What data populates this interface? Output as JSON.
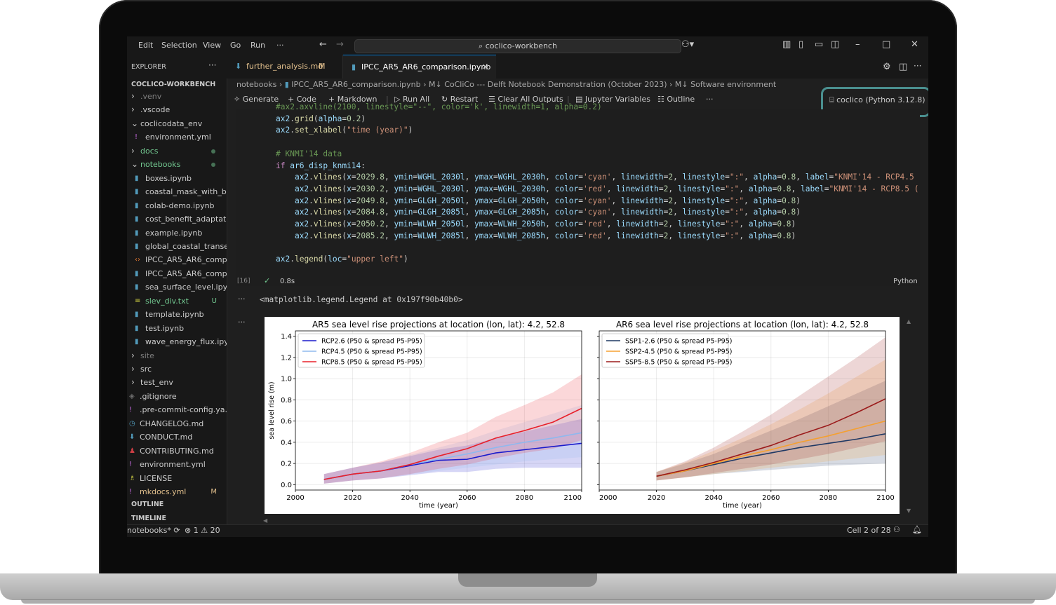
{
  "menu": [
    "Edit",
    "Selection",
    "View",
    "Go",
    "Run",
    "···"
  ],
  "search": {
    "label": "coclico-workbench"
  },
  "explorer": {
    "header": "EXPLORER",
    "root": "COCLICO-WORKBENCH",
    "items": [
      {
        "label": ".venv",
        "kind": "folder",
        "depth": 0,
        "open": false,
        "color": "#7f7f7f"
      },
      {
        "label": ".vscode",
        "kind": "folder",
        "depth": 0,
        "open": false,
        "color": "#cccccc"
      },
      {
        "label": "coclicodata_env",
        "kind": "folder",
        "depth": 0,
        "open": true,
        "color": "#cccccc"
      },
      {
        "label": "environment.yml",
        "kind": "yml",
        "depth": 1,
        "color": "#cccccc"
      },
      {
        "label": "docs",
        "kind": "folder",
        "depth": 0,
        "open": false,
        "color": "#73c991",
        "dot": true
      },
      {
        "label": "notebooks",
        "kind": "folder",
        "depth": 0,
        "open": true,
        "color": "#73c991",
        "dot": true
      },
      {
        "label": "boxes.ipynb",
        "kind": "nb",
        "depth": 1,
        "color": "#cccccc"
      },
      {
        "label": "coastal_mask_with_b...",
        "kind": "nb",
        "depth": 1,
        "color": "#cccccc"
      },
      {
        "label": "colab-demo.ipynb",
        "kind": "nb",
        "depth": 1,
        "color": "#cccccc"
      },
      {
        "label": "cost_benefit_adaptati...",
        "kind": "nb",
        "depth": 1,
        "color": "#cccccc"
      },
      {
        "label": "example.ipynb",
        "kind": "nb",
        "depth": 1,
        "color": "#cccccc"
      },
      {
        "label": "global_coastal_transe...",
        "kind": "nb",
        "depth": 1,
        "color": "#cccccc"
      },
      {
        "label": "IPCC_AR5_AR6_comp...",
        "kind": "code",
        "depth": 1,
        "color": "#cccccc"
      },
      {
        "label": "IPCC_AR5_AR6_comp...",
        "kind": "nb",
        "depth": 1,
        "color": "#cccccc"
      },
      {
        "label": "sea_surface_level.ipynb",
        "kind": "nb",
        "depth": 1,
        "color": "#cccccc"
      },
      {
        "label": "slev_div.txt",
        "kind": "txt",
        "depth": 1,
        "color": "#73c991",
        "badge": "U"
      },
      {
        "label": "template.ipynb",
        "kind": "nb",
        "depth": 1,
        "color": "#cccccc"
      },
      {
        "label": "test.ipynb",
        "kind": "nb",
        "depth": 1,
        "color": "#cccccc"
      },
      {
        "label": "wave_energy_flux.ipy...",
        "kind": "nb",
        "depth": 1,
        "color": "#cccccc"
      },
      {
        "label": "site",
        "kind": "folder",
        "depth": 0,
        "open": false,
        "color": "#7f7f7f"
      },
      {
        "label": "src",
        "kind": "folder",
        "depth": 0,
        "open": false,
        "color": "#cccccc"
      },
      {
        "label": "test_env",
        "kind": "folder",
        "depth": 0,
        "open": false,
        "color": "#cccccc"
      },
      {
        "label": ".gitignore",
        "kind": "git",
        "depth": -1,
        "color": "#cccccc"
      },
      {
        "label": ".pre-commit-config.ya...",
        "kind": "yml",
        "depth": -1,
        "color": "#cccccc"
      },
      {
        "label": "CHANGELOG.md",
        "kind": "clock",
        "depth": -1,
        "color": "#cccccc"
      },
      {
        "label": "CONDUCT.md",
        "kind": "md",
        "depth": -1,
        "color": "#cccccc"
      },
      {
        "label": "CONTRIBUTING.md",
        "kind": "person",
        "depth": -1,
        "color": "#cccccc"
      },
      {
        "label": "environment.yml",
        "kind": "yml",
        "depth": -1,
        "color": "#cccccc"
      },
      {
        "label": "LICENSE",
        "kind": "license",
        "depth": -1,
        "color": "#cccccc"
      },
      {
        "label": "mkdocs.yml",
        "kind": "yml",
        "depth": -1,
        "color": "#e2c08d",
        "badge": "M"
      }
    ],
    "outline": "OUTLINE",
    "timeline": "TIMELINE"
  },
  "tabs": [
    {
      "label": "further_analysis.md",
      "badge": "M",
      "active": false
    },
    {
      "label": "IPCC_AR5_AR6_comparison.ipynb",
      "active": true
    }
  ],
  "breadcrumb": {
    "parts": [
      "notebooks",
      "IPCC_AR5_AR6_comparison.ipynb",
      "M↓ CoCliCo --- Delft Notebook Demonstration (October 2023)",
      "M↓ Software environment"
    ]
  },
  "toolbar": {
    "generate": "Generate",
    "code": "Code",
    "markdown": "Markdown",
    "run_all": "Run All",
    "restart": "Restart",
    "clear": "Clear All Outputs",
    "variables": "Jupyter Variables",
    "outline": "Outline",
    "more": "···",
    "kernel": "coclico (Python 3.12.8)"
  },
  "cell": {
    "exec_count": "[16]",
    "time": "0.8s",
    "language": "Python",
    "lines": [
      "#ax2.axvline(2100, linestyle=\"--\", color='k', linewidth=1, alpha=0.2)",
      "ax2.grid(alpha=0.2)",
      "ax2.set_xlabel(\"time (year)\")",
      "",
      "# KNMI'14 data",
      "if ar6_disp_knmi14:",
      "    ax2.vlines(x=2029.8, ymin=WGHL_2030l, ymax=WGHL_2030h, color='cyan', linewidth=2, linestyle=\":\", alpha=0.8, label=\"KNMI'14 - RCP4.5",
      "    ax2.vlines(x=2030.2, ymin=WGHL_2030l, ymax=WGHL_2030h, color='red', linewidth=2, linestyle=\":\", alpha=0.8, label=\"KNMI'14 - RCP8.5 (",
      "    ax2.vlines(x=2049.8, ymin=GLGH_2050l, ymax=GLGH_2050h, color='cyan', linewidth=2, linestyle=\":\", alpha=0.8)",
      "    ax2.vlines(x=2084.8, ymin=GLGH_2085l, ymax=GLGH_2085h, color='cyan', linewidth=2, linestyle=\":\", alpha=0.8)",
      "    ax2.vlines(x=2050.2, ymin=WLWH_2050l, ymax=WLWH_2050h, color='red', linewidth=2, linestyle=\":\", alpha=0.8)",
      "    ax2.vlines(x=2085.2, ymin=WLWH_2085l, ymax=WLWH_2085h, color='red', linewidth=2, linestyle=\":\", alpha=0.8)",
      "",
      "ax2.legend(loc=\"upper left\")"
    ],
    "output_text": "<matplotlib.legend.Legend at 0x197f90b40b0>"
  },
  "chart_data": [
    {
      "type": "line",
      "title": "AR5 sea level rise projections at location (lon, lat): 4.2, 52.8",
      "xlabel": "time (year)",
      "ylabel": "sea level rise (m)",
      "xlim": [
        2000,
        2100
      ],
      "ylim": [
        -0.05,
        1.45
      ],
      "xticks": [
        2000,
        2020,
        2040,
        2060,
        2080,
        2100
      ],
      "yticks": [
        0.0,
        0.2,
        0.4,
        0.6,
        0.8,
        1.0,
        1.2,
        1.4
      ],
      "legend": "upper-left",
      "grid": true,
      "x": [
        2010,
        2020,
        2030,
        2040,
        2050,
        2060,
        2070,
        2080,
        2090,
        2100
      ],
      "series": [
        {
          "name": "RCP2.6 (P50 & spread P5-P95)",
          "color": "#1a1acc",
          "values": [
            0.05,
            0.1,
            0.13,
            0.18,
            0.23,
            0.24,
            0.3,
            0.33,
            0.36,
            0.39
          ],
          "low": [
            0.01,
            0.04,
            0.06,
            0.09,
            0.12,
            0.12,
            0.15,
            0.16,
            0.16,
            0.16
          ],
          "high": [
            0.1,
            0.16,
            0.21,
            0.27,
            0.33,
            0.37,
            0.44,
            0.5,
            0.56,
            0.62
          ]
        },
        {
          "name": "RCP4.5 (P50 & spread P5-P95)",
          "color": "#8fb8ee",
          "values": [
            0.05,
            0.1,
            0.13,
            0.19,
            0.24,
            0.29,
            0.35,
            0.4,
            0.44,
            0.49
          ],
          "low": [
            0.01,
            0.04,
            0.06,
            0.1,
            0.13,
            0.16,
            0.19,
            0.22,
            0.24,
            0.26
          ],
          "high": [
            0.1,
            0.16,
            0.21,
            0.28,
            0.35,
            0.42,
            0.51,
            0.59,
            0.67,
            0.75
          ]
        },
        {
          "name": "RCP8.5 (P50 & spread P5-P95)",
          "color": "#e8202a",
          "values": [
            0.05,
            0.1,
            0.13,
            0.19,
            0.27,
            0.34,
            0.44,
            0.51,
            0.59,
            0.72
          ],
          "low": [
            0.01,
            0.04,
            0.06,
            0.1,
            0.15,
            0.19,
            0.25,
            0.3,
            0.34,
            0.42
          ],
          "high": [
            0.1,
            0.16,
            0.22,
            0.3,
            0.4,
            0.49,
            0.64,
            0.75,
            0.87,
            1.04
          ]
        }
      ]
    },
    {
      "type": "line",
      "title": "AR6 sea level rise projections at location (lon, lat): 4.2, 52.8",
      "xlabel": "time (year)",
      "ylabel": "",
      "xlim": [
        2000,
        2100
      ],
      "ylim": [
        -0.05,
        1.45
      ],
      "xticks": [
        2000,
        2020,
        2040,
        2060,
        2080,
        2100
      ],
      "legend": "upper-left",
      "grid": true,
      "x": [
        2020,
        2030,
        2040,
        2050,
        2060,
        2070,
        2080,
        2090,
        2100
      ],
      "series": [
        {
          "name": "SSP1-2.6 (P50 & spread P5-P95)",
          "color": "#1f3864",
          "values": [
            0.08,
            0.13,
            0.19,
            0.25,
            0.3,
            0.35,
            0.39,
            0.43,
            0.48
          ],
          "low": [
            0.04,
            0.07,
            0.1,
            0.12,
            0.14,
            0.16,
            0.18,
            0.19,
            0.2
          ],
          "high": [
            0.12,
            0.2,
            0.29,
            0.4,
            0.51,
            0.62,
            0.74,
            0.86,
            0.98
          ]
        },
        {
          "name": "SSP2-4.5 (P50 & spread P5-P95)",
          "color": "#f5a030",
          "values": [
            0.08,
            0.13,
            0.2,
            0.27,
            0.33,
            0.4,
            0.46,
            0.53,
            0.6
          ],
          "low": [
            0.04,
            0.07,
            0.1,
            0.13,
            0.16,
            0.19,
            0.22,
            0.25,
            0.28
          ],
          "high": [
            0.12,
            0.21,
            0.32,
            0.44,
            0.57,
            0.71,
            0.86,
            1.02,
            1.18
          ]
        },
        {
          "name": "SSP5-8.5 (P50 & spread P5-P95)",
          "color": "#9b1b1b",
          "values": [
            0.08,
            0.14,
            0.21,
            0.29,
            0.37,
            0.47,
            0.56,
            0.68,
            0.81
          ],
          "low": [
            0.04,
            0.07,
            0.11,
            0.15,
            0.19,
            0.24,
            0.29,
            0.35,
            0.41
          ],
          "high": [
            0.12,
            0.22,
            0.35,
            0.5,
            0.66,
            0.84,
            1.02,
            1.2,
            1.39
          ]
        }
      ]
    }
  ],
  "status": {
    "branch": "notebooks*",
    "errors": "1",
    "warnings": "20",
    "cell_pos": "Cell 2 of 28"
  }
}
